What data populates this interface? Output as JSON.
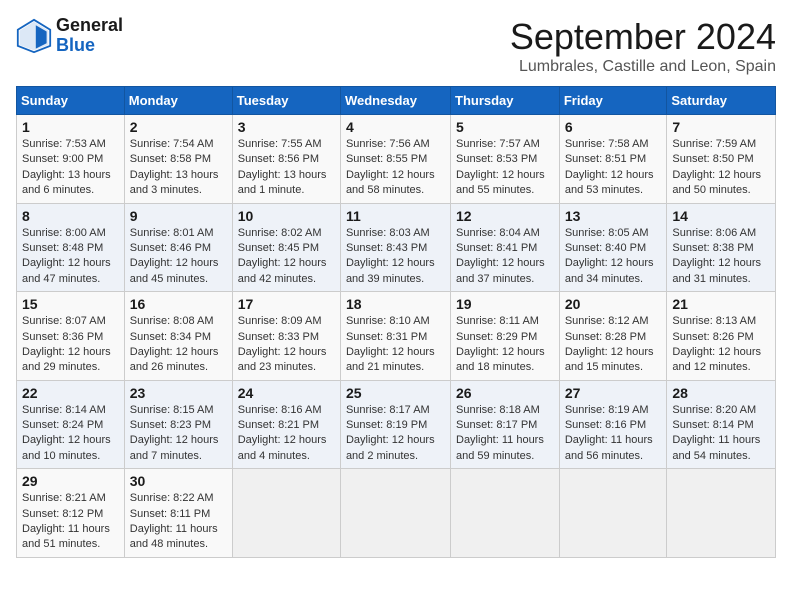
{
  "header": {
    "logo": {
      "line1": "General",
      "line2": "Blue"
    },
    "title": "September 2024",
    "subtitle": "Lumbrales, Castille and Leon, Spain"
  },
  "calendar": {
    "columns": [
      "Sunday",
      "Monday",
      "Tuesday",
      "Wednesday",
      "Thursday",
      "Friday",
      "Saturday"
    ],
    "rows": [
      [
        {
          "day": "1",
          "sunrise": "7:53 AM",
          "sunset": "9:00 PM",
          "daylight": "13 hours and 6 minutes."
        },
        {
          "day": "2",
          "sunrise": "7:54 AM",
          "sunset": "8:58 PM",
          "daylight": "13 hours and 3 minutes."
        },
        {
          "day": "3",
          "sunrise": "7:55 AM",
          "sunset": "8:56 PM",
          "daylight": "13 hours and 1 minute."
        },
        {
          "day": "4",
          "sunrise": "7:56 AM",
          "sunset": "8:55 PM",
          "daylight": "12 hours and 58 minutes."
        },
        {
          "day": "5",
          "sunrise": "7:57 AM",
          "sunset": "8:53 PM",
          "daylight": "12 hours and 55 minutes."
        },
        {
          "day": "6",
          "sunrise": "7:58 AM",
          "sunset": "8:51 PM",
          "daylight": "12 hours and 53 minutes."
        },
        {
          "day": "7",
          "sunrise": "7:59 AM",
          "sunset": "8:50 PM",
          "daylight": "12 hours and 50 minutes."
        }
      ],
      [
        {
          "day": "8",
          "sunrise": "8:00 AM",
          "sunset": "8:48 PM",
          "daylight": "12 hours and 47 minutes."
        },
        {
          "day": "9",
          "sunrise": "8:01 AM",
          "sunset": "8:46 PM",
          "daylight": "12 hours and 45 minutes."
        },
        {
          "day": "10",
          "sunrise": "8:02 AM",
          "sunset": "8:45 PM",
          "daylight": "12 hours and 42 minutes."
        },
        {
          "day": "11",
          "sunrise": "8:03 AM",
          "sunset": "8:43 PM",
          "daylight": "12 hours and 39 minutes."
        },
        {
          "day": "12",
          "sunrise": "8:04 AM",
          "sunset": "8:41 PM",
          "daylight": "12 hours and 37 minutes."
        },
        {
          "day": "13",
          "sunrise": "8:05 AM",
          "sunset": "8:40 PM",
          "daylight": "12 hours and 34 minutes."
        },
        {
          "day": "14",
          "sunrise": "8:06 AM",
          "sunset": "8:38 PM",
          "daylight": "12 hours and 31 minutes."
        }
      ],
      [
        {
          "day": "15",
          "sunrise": "8:07 AM",
          "sunset": "8:36 PM",
          "daylight": "12 hours and 29 minutes."
        },
        {
          "day": "16",
          "sunrise": "8:08 AM",
          "sunset": "8:34 PM",
          "daylight": "12 hours and 26 minutes."
        },
        {
          "day": "17",
          "sunrise": "8:09 AM",
          "sunset": "8:33 PM",
          "daylight": "12 hours and 23 minutes."
        },
        {
          "day": "18",
          "sunrise": "8:10 AM",
          "sunset": "8:31 PM",
          "daylight": "12 hours and 21 minutes."
        },
        {
          "day": "19",
          "sunrise": "8:11 AM",
          "sunset": "8:29 PM",
          "daylight": "12 hours and 18 minutes."
        },
        {
          "day": "20",
          "sunrise": "8:12 AM",
          "sunset": "8:28 PM",
          "daylight": "12 hours and 15 minutes."
        },
        {
          "day": "21",
          "sunrise": "8:13 AM",
          "sunset": "8:26 PM",
          "daylight": "12 hours and 12 minutes."
        }
      ],
      [
        {
          "day": "22",
          "sunrise": "8:14 AM",
          "sunset": "8:24 PM",
          "daylight": "12 hours and 10 minutes."
        },
        {
          "day": "23",
          "sunrise": "8:15 AM",
          "sunset": "8:23 PM",
          "daylight": "12 hours and 7 minutes."
        },
        {
          "day": "24",
          "sunrise": "8:16 AM",
          "sunset": "8:21 PM",
          "daylight": "12 hours and 4 minutes."
        },
        {
          "day": "25",
          "sunrise": "8:17 AM",
          "sunset": "8:19 PM",
          "daylight": "12 hours and 2 minutes."
        },
        {
          "day": "26",
          "sunrise": "8:18 AM",
          "sunset": "8:17 PM",
          "daylight": "11 hours and 59 minutes."
        },
        {
          "day": "27",
          "sunrise": "8:19 AM",
          "sunset": "8:16 PM",
          "daylight": "11 hours and 56 minutes."
        },
        {
          "day": "28",
          "sunrise": "8:20 AM",
          "sunset": "8:14 PM",
          "daylight": "11 hours and 54 minutes."
        }
      ],
      [
        {
          "day": "29",
          "sunrise": "8:21 AM",
          "sunset": "8:12 PM",
          "daylight": "11 hours and 51 minutes."
        },
        {
          "day": "30",
          "sunrise": "8:22 AM",
          "sunset": "8:11 PM",
          "daylight": "11 hours and 48 minutes."
        },
        null,
        null,
        null,
        null,
        null
      ]
    ]
  }
}
